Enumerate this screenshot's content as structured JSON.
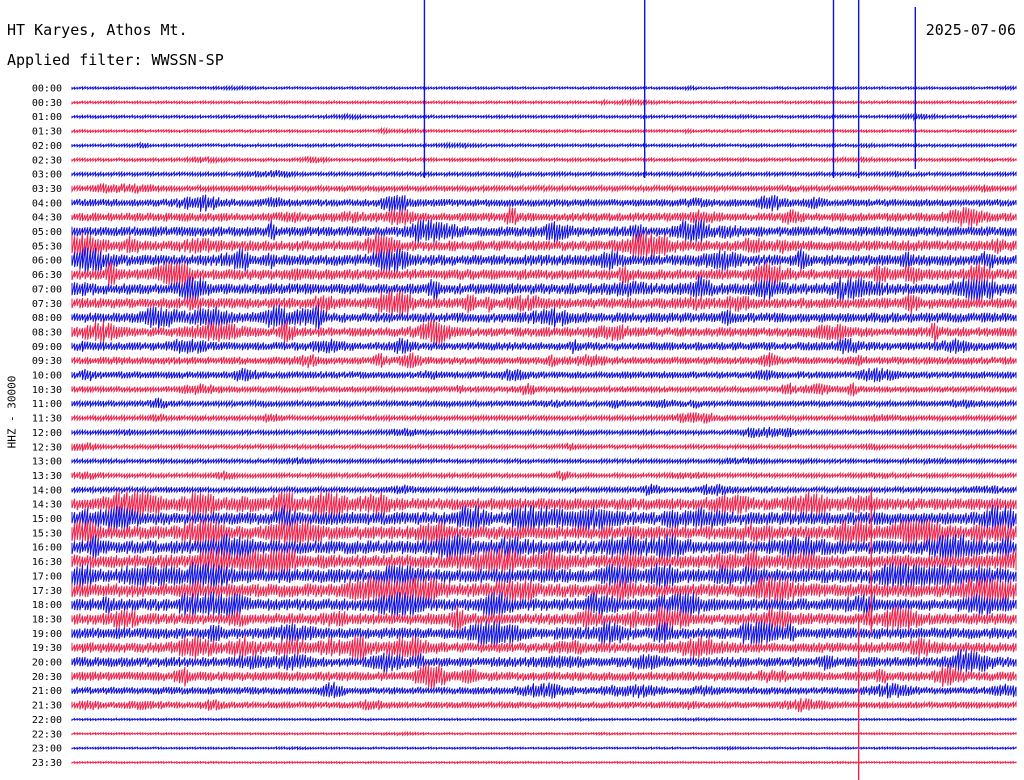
{
  "header": {
    "station": "HT Karyes, Athos Mt.",
    "date": "2025-07-06",
    "filter": "Applied filter: WWSSN-SP"
  },
  "colors": {
    "trace_a": "#1010e0",
    "trace_b": "#f0204a",
    "background": "#ffffff"
  },
  "chart_data": {
    "type": "line",
    "title": "HT Karyes, Athos Mt.",
    "subtitle": "Applied filter: WWSSN-SP",
    "ylabel": "HHZ - 30000",
    "xlabel": "",
    "date": "2025-07-06",
    "row_labels": [
      "00:00",
      "00:30",
      "01:00",
      "01:30",
      "02:00",
      "02:30",
      "03:00",
      "03:30",
      "04:00",
      "04:30",
      "05:00",
      "05:30",
      "06:00",
      "06:30",
      "07:00",
      "07:30",
      "08:00",
      "08:30",
      "09:00",
      "09:30",
      "10:00",
      "10:30",
      "11:00",
      "11:30",
      "12:00",
      "12:30",
      "13:00",
      "13:30",
      "14:00",
      "14:30",
      "15:00",
      "15:30",
      "16:00",
      "16:30",
      "17:00",
      "17:30",
      "18:00",
      "18:30",
      "19:00",
      "19:30",
      "20:00",
      "20:30",
      "21:00",
      "21:30",
      "22:00",
      "22:30",
      "23:00",
      "23:30"
    ],
    "series": [
      {
        "color": "#1010e0",
        "rows": "even"
      },
      {
        "color": "#f0204a",
        "rows": "odd"
      }
    ],
    "activity_level": [
      0.08,
      0.1,
      0.12,
      0.1,
      0.12,
      0.14,
      0.18,
      0.28,
      0.4,
      0.48,
      0.55,
      0.6,
      0.62,
      0.6,
      0.62,
      0.6,
      0.55,
      0.52,
      0.45,
      0.42,
      0.38,
      0.32,
      0.3,
      0.26,
      0.22,
      0.2,
      0.2,
      0.22,
      0.28,
      0.7,
      0.75,
      0.78,
      0.78,
      0.8,
      0.82,
      0.8,
      0.7,
      0.66,
      0.62,
      0.58,
      0.55,
      0.52,
      0.4,
      0.35,
      0.06,
      0.05,
      0.05,
      0.04
    ],
    "events": [
      {
        "time": "00:00",
        "minute": 11.2,
        "amp": 1.0
      },
      {
        "time": "00:00",
        "minute": 18.2,
        "amp": 1.0
      },
      {
        "time": "00:00",
        "minute": 24.2,
        "amp": 1.0
      },
      {
        "time": "00:00",
        "minute": 25.0,
        "amp": 1.0
      },
      {
        "time": "00:00",
        "minute": 26.8,
        "amp": 0.9
      },
      {
        "time": "16:30",
        "minute": 25.4,
        "amp": 0.8
      },
      {
        "time": "21:30",
        "minute": 25.0,
        "amp": 1.0
      }
    ],
    "grid": false,
    "legend": "none"
  }
}
